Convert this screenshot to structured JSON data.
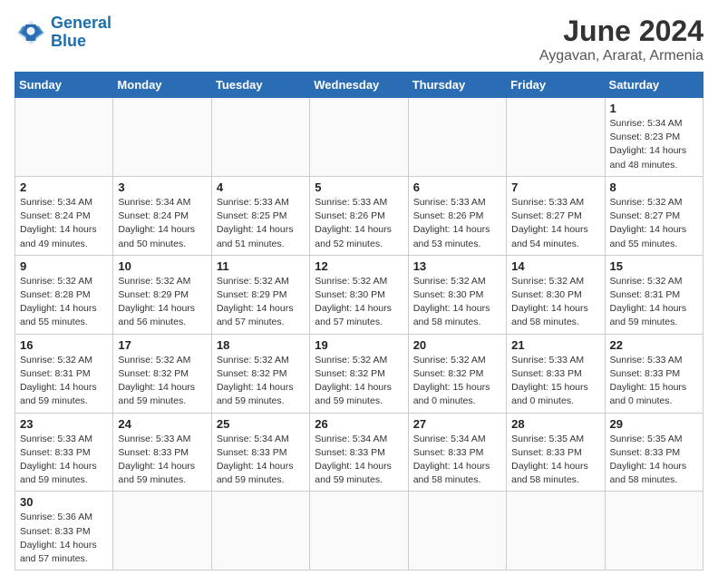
{
  "header": {
    "logo_general": "General",
    "logo_blue": "Blue",
    "month_year": "June 2024",
    "location": "Aygavan, Ararat, Armenia"
  },
  "weekdays": [
    "Sunday",
    "Monday",
    "Tuesday",
    "Wednesday",
    "Thursday",
    "Friday",
    "Saturday"
  ],
  "weeks": [
    [
      {
        "day": "",
        "content": ""
      },
      {
        "day": "",
        "content": ""
      },
      {
        "day": "",
        "content": ""
      },
      {
        "day": "",
        "content": ""
      },
      {
        "day": "",
        "content": ""
      },
      {
        "day": "",
        "content": ""
      },
      {
        "day": "1",
        "content": "Sunrise: 5:34 AM\nSunset: 8:23 PM\nDaylight: 14 hours and 48 minutes."
      }
    ],
    [
      {
        "day": "2",
        "content": "Sunrise: 5:34 AM\nSunset: 8:24 PM\nDaylight: 14 hours and 49 minutes."
      },
      {
        "day": "3",
        "content": "Sunrise: 5:34 AM\nSunset: 8:24 PM\nDaylight: 14 hours and 50 minutes."
      },
      {
        "day": "4",
        "content": "Sunrise: 5:33 AM\nSunset: 8:25 PM\nDaylight: 14 hours and 51 minutes."
      },
      {
        "day": "5",
        "content": "Sunrise: 5:33 AM\nSunset: 8:26 PM\nDaylight: 14 hours and 52 minutes."
      },
      {
        "day": "6",
        "content": "Sunrise: 5:33 AM\nSunset: 8:26 PM\nDaylight: 14 hours and 53 minutes."
      },
      {
        "day": "7",
        "content": "Sunrise: 5:33 AM\nSunset: 8:27 PM\nDaylight: 14 hours and 54 minutes."
      },
      {
        "day": "8",
        "content": "Sunrise: 5:32 AM\nSunset: 8:27 PM\nDaylight: 14 hours and 55 minutes."
      }
    ],
    [
      {
        "day": "9",
        "content": "Sunrise: 5:32 AM\nSunset: 8:28 PM\nDaylight: 14 hours and 55 minutes."
      },
      {
        "day": "10",
        "content": "Sunrise: 5:32 AM\nSunset: 8:29 PM\nDaylight: 14 hours and 56 minutes."
      },
      {
        "day": "11",
        "content": "Sunrise: 5:32 AM\nSunset: 8:29 PM\nDaylight: 14 hours and 57 minutes."
      },
      {
        "day": "12",
        "content": "Sunrise: 5:32 AM\nSunset: 8:30 PM\nDaylight: 14 hours and 57 minutes."
      },
      {
        "day": "13",
        "content": "Sunrise: 5:32 AM\nSunset: 8:30 PM\nDaylight: 14 hours and 58 minutes."
      },
      {
        "day": "14",
        "content": "Sunrise: 5:32 AM\nSunset: 8:30 PM\nDaylight: 14 hours and 58 minutes."
      },
      {
        "day": "15",
        "content": "Sunrise: 5:32 AM\nSunset: 8:31 PM\nDaylight: 14 hours and 59 minutes."
      }
    ],
    [
      {
        "day": "16",
        "content": "Sunrise: 5:32 AM\nSunset: 8:31 PM\nDaylight: 14 hours and 59 minutes."
      },
      {
        "day": "17",
        "content": "Sunrise: 5:32 AM\nSunset: 8:32 PM\nDaylight: 14 hours and 59 minutes."
      },
      {
        "day": "18",
        "content": "Sunrise: 5:32 AM\nSunset: 8:32 PM\nDaylight: 14 hours and 59 minutes."
      },
      {
        "day": "19",
        "content": "Sunrise: 5:32 AM\nSunset: 8:32 PM\nDaylight: 14 hours and 59 minutes."
      },
      {
        "day": "20",
        "content": "Sunrise: 5:32 AM\nSunset: 8:32 PM\nDaylight: 15 hours and 0 minutes."
      },
      {
        "day": "21",
        "content": "Sunrise: 5:33 AM\nSunset: 8:33 PM\nDaylight: 15 hours and 0 minutes."
      },
      {
        "day": "22",
        "content": "Sunrise: 5:33 AM\nSunset: 8:33 PM\nDaylight: 15 hours and 0 minutes."
      }
    ],
    [
      {
        "day": "23",
        "content": "Sunrise: 5:33 AM\nSunset: 8:33 PM\nDaylight: 14 hours and 59 minutes."
      },
      {
        "day": "24",
        "content": "Sunrise: 5:33 AM\nSunset: 8:33 PM\nDaylight: 14 hours and 59 minutes."
      },
      {
        "day": "25",
        "content": "Sunrise: 5:34 AM\nSunset: 8:33 PM\nDaylight: 14 hours and 59 minutes."
      },
      {
        "day": "26",
        "content": "Sunrise: 5:34 AM\nSunset: 8:33 PM\nDaylight: 14 hours and 59 minutes."
      },
      {
        "day": "27",
        "content": "Sunrise: 5:34 AM\nSunset: 8:33 PM\nDaylight: 14 hours and 58 minutes."
      },
      {
        "day": "28",
        "content": "Sunrise: 5:35 AM\nSunset: 8:33 PM\nDaylight: 14 hours and 58 minutes."
      },
      {
        "day": "29",
        "content": "Sunrise: 5:35 AM\nSunset: 8:33 PM\nDaylight: 14 hours and 58 minutes."
      }
    ],
    [
      {
        "day": "30",
        "content": "Sunrise: 5:36 AM\nSunset: 8:33 PM\nDaylight: 14 hours and 57 minutes."
      },
      {
        "day": "",
        "content": ""
      },
      {
        "day": "",
        "content": ""
      },
      {
        "day": "",
        "content": ""
      },
      {
        "day": "",
        "content": ""
      },
      {
        "day": "",
        "content": ""
      },
      {
        "day": "",
        "content": ""
      }
    ]
  ]
}
